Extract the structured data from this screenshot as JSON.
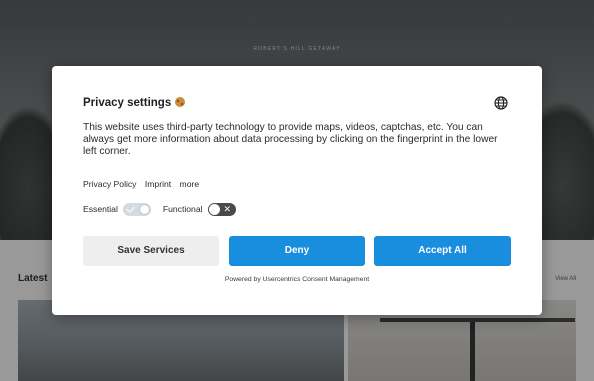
{
  "background": {
    "site_title": "ROBERT'S HILL GETAWAY",
    "latest_heading": "Latest",
    "view_all": "View All"
  },
  "dialog": {
    "title": "Privacy settings",
    "title_icon": "cookie-icon",
    "language_icon": "globe-icon",
    "description": "This website uses third-party technology to provide maps, videos, captchas, etc. You can always get more information about data processing by clicking on the fingerprint in the lower left corner.",
    "links": {
      "privacy_policy": "Privacy Policy",
      "imprint": "Imprint",
      "more": "more"
    },
    "toggles": {
      "essential": {
        "label": "Essential",
        "on": true,
        "disabled": true
      },
      "functional": {
        "label": "Functional",
        "on": false
      }
    },
    "buttons": {
      "save": "Save Services",
      "deny": "Deny",
      "accept": "Accept All"
    },
    "powered_by": "Powered by Usercentrics Consent Management"
  },
  "colors": {
    "primary_button": "#1a8ede",
    "secondary_button": "#eeeeee",
    "toggle_off": "#4a4a4a"
  }
}
